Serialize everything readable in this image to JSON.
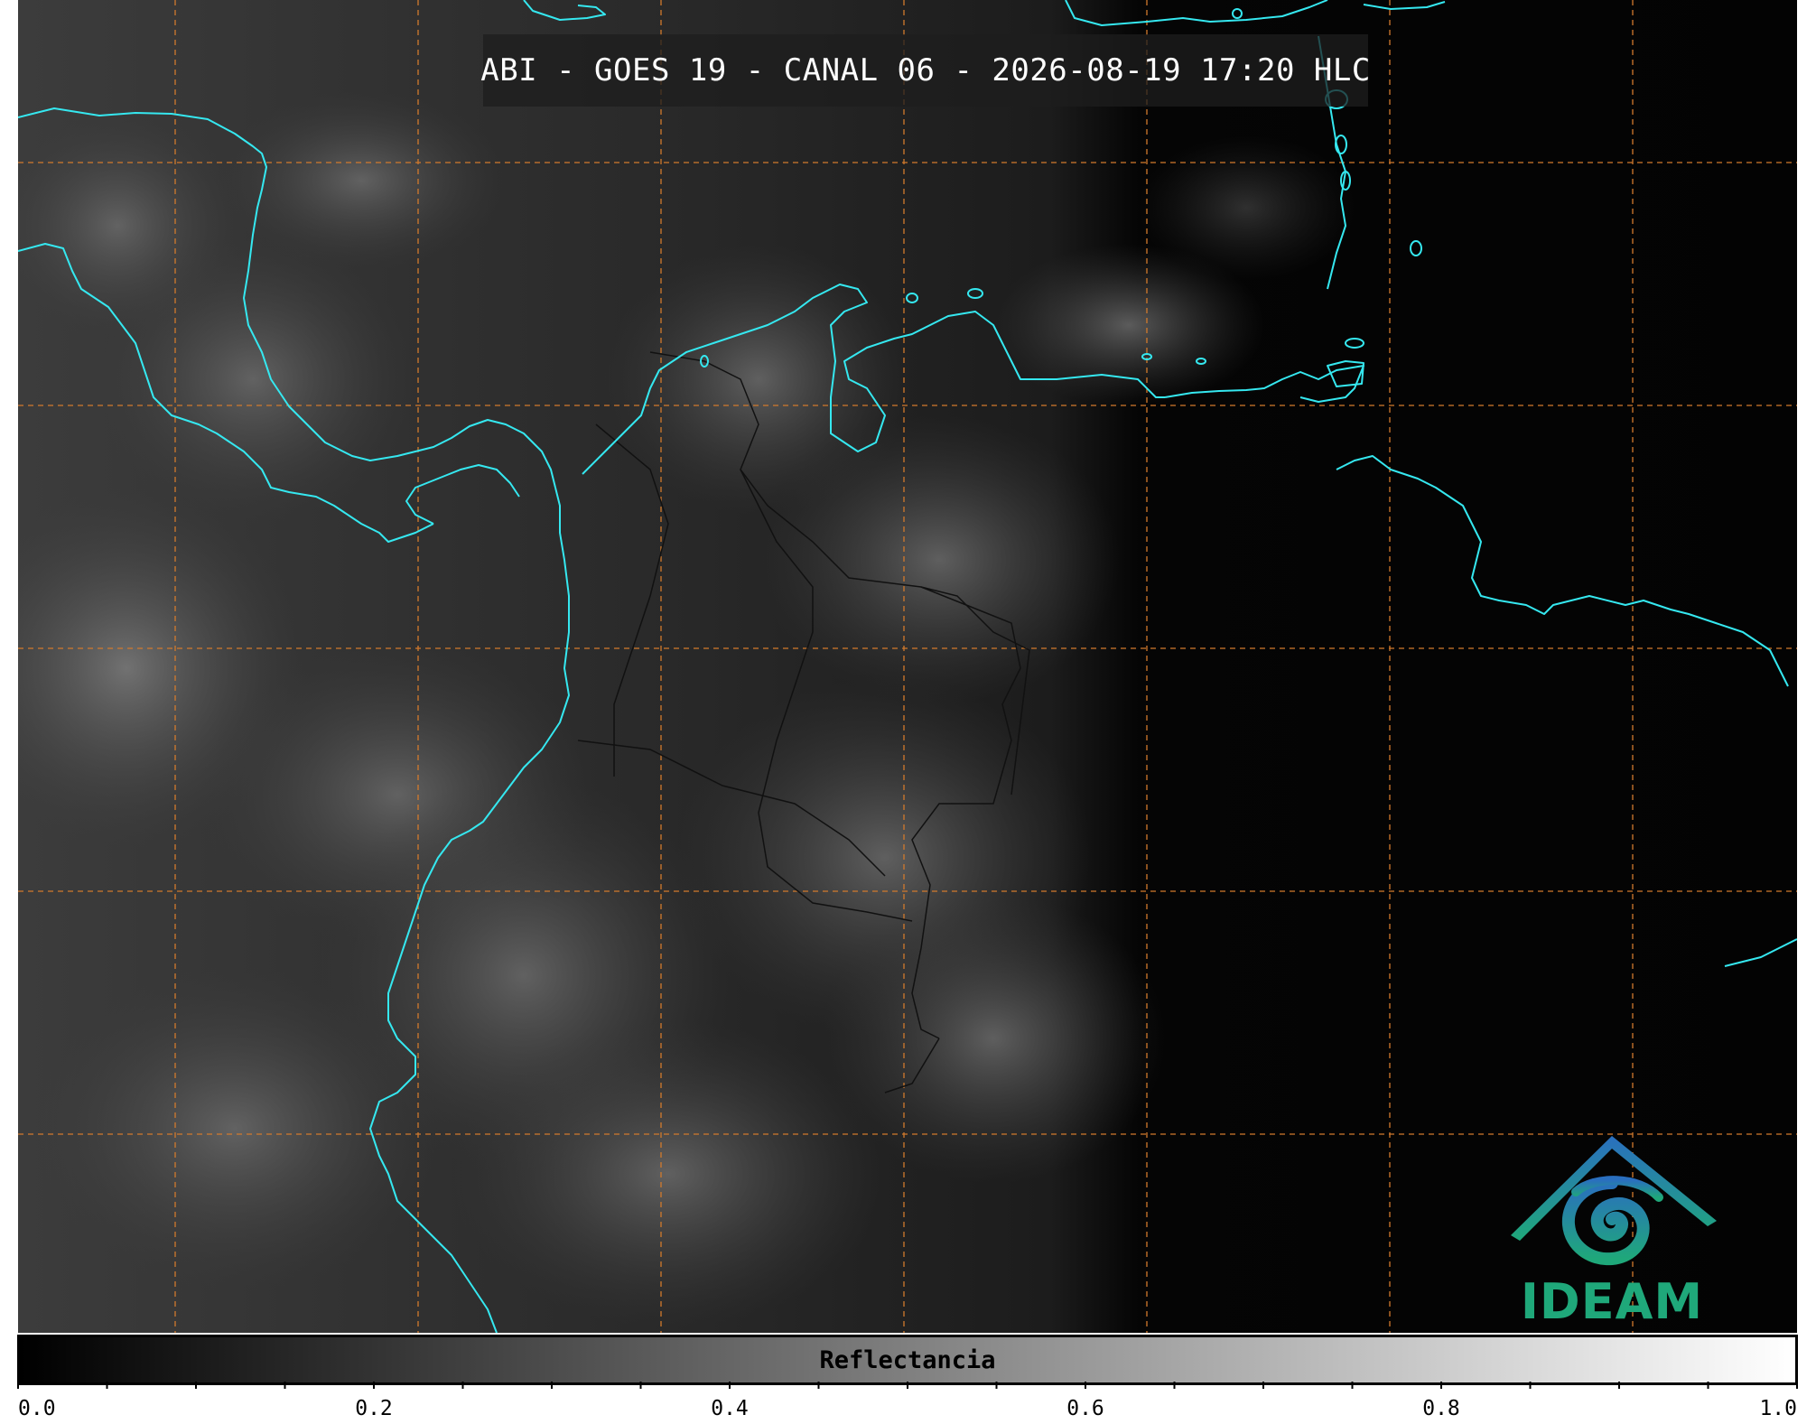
{
  "title": "ABI - GOES 19 - CANAL 06 - 2026-08-19 17:20 HLC",
  "logo": {
    "name": "IDEAM",
    "icon": "ideam-mountain-swirl-icon",
    "colors": {
      "top": "#2a6fbf",
      "bottom": "#1fa87a"
    }
  },
  "colorbar": {
    "label": "Reflectancia",
    "min": 0.0,
    "max": 1.0,
    "colormap": "gray",
    "major_ticks": [
      "0.0",
      "0.2",
      "0.4",
      "0.6",
      "0.8",
      "1.0"
    ],
    "minor_tick_step": 0.05
  },
  "map": {
    "background": "#050505",
    "coastline_color": "#35e8f0",
    "gridline_color": "#d27a2c",
    "gridline_style": "dashed",
    "border_color": "#111111",
    "grid_columns": 7,
    "grid_rows": 5
  }
}
